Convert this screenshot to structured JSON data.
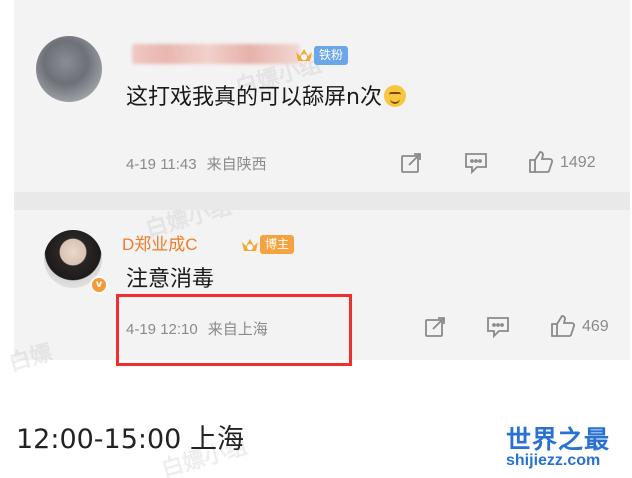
{
  "comments": [
    {
      "user_tag": "铁粉",
      "text": "这打戏我真的可以舔屏n次",
      "time": "4-19 11:43",
      "source": "来自陕西",
      "likes": "1492"
    },
    {
      "username": "D郑业成C",
      "user_tag": "博主",
      "text": "注意消毒",
      "time": "4-19 12:10",
      "source": "来自上海",
      "likes": "469"
    }
  ],
  "caption": "12:00-15:00 上海",
  "logo": {
    "cn": "世界之最",
    "en": "shijiezz.com"
  },
  "icons": {
    "repost": "repost-icon",
    "comment": "comment-icon",
    "like": "thumbs-up-icon",
    "level": "crown-level-icon",
    "verified": "verified-badge-icon"
  },
  "colors": {
    "username": "#f07c2b",
    "fan_tag": "#6aa6e8",
    "blogger_tag": "#f4a33f",
    "highlight": "#ee2f2f",
    "logo": "#2a72d1"
  }
}
